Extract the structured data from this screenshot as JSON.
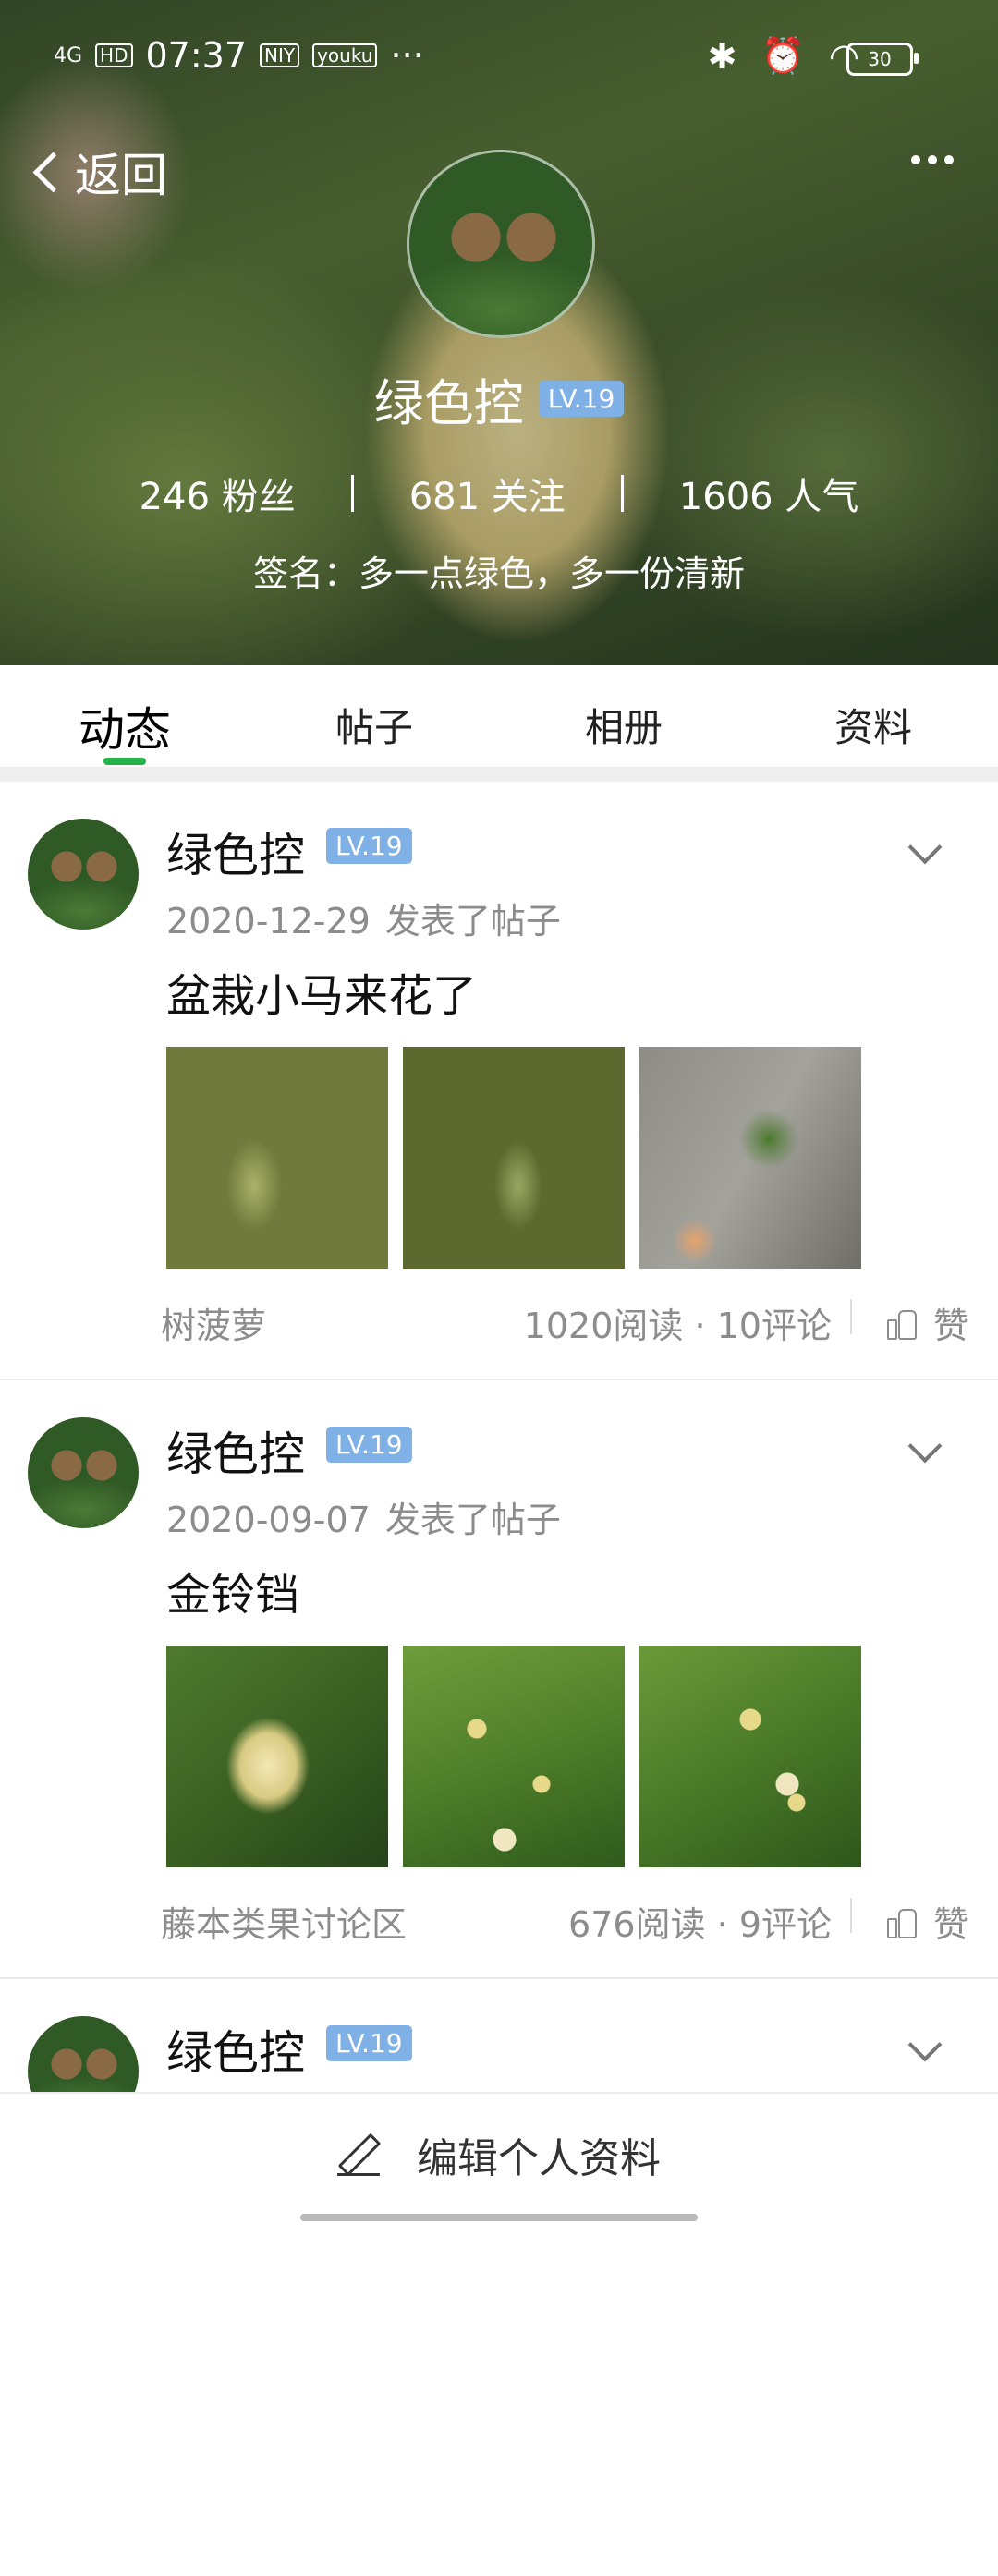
{
  "status_bar": {
    "time": "07:37",
    "signal": "4G",
    "hd": "HD",
    "battery": "30",
    "app_icons": [
      "NIY",
      "youku"
    ],
    "more": "···"
  },
  "header": {
    "back_label": "返回",
    "user_name": "绿色控",
    "level": "LV.19",
    "stats": [
      {
        "value": "246 粉丝"
      },
      {
        "value": "681 关注"
      },
      {
        "value": "1606 人气"
      }
    ],
    "signature": "签名：多一点绿色，多一份清新"
  },
  "tabs": [
    {
      "label": "动态",
      "active": true
    },
    {
      "label": "帖子",
      "active": false
    },
    {
      "label": "相册",
      "active": false
    },
    {
      "label": "资料",
      "active": false
    }
  ],
  "posts": [
    {
      "author": "绿色控",
      "level": "LV.19",
      "date": "2020-12-29",
      "action": "发表了帖子",
      "title": "盆栽小马来花了",
      "tag": "树菠萝",
      "stats": "1020阅读 · 10评论",
      "like_label": "赞"
    },
    {
      "author": "绿色控",
      "level": "LV.19",
      "date": "2020-09-07",
      "action": "发表了帖子",
      "title": "金铃铛",
      "tag": "藤本类果讨论区",
      "stats": "676阅读 · 9评论",
      "like_label": "赞"
    },
    {
      "author": "绿色控",
      "level": "LV.19"
    }
  ],
  "bottom": {
    "edit_label": "编辑个人资料"
  },
  "colors": {
    "accent_green": "#25b24a",
    "level_badge": "#7fb0e6",
    "meta_gray": "#8c8c8c"
  }
}
